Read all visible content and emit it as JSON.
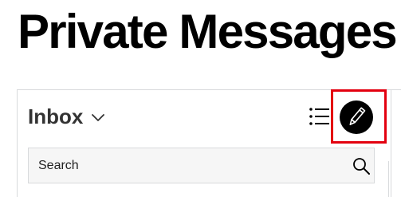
{
  "page": {
    "title": "Private Messages"
  },
  "inbox": {
    "folder_label": "Inbox",
    "folder_icon": "chevron-down-icon"
  },
  "toolbar": {
    "list_view_icon": "list-icon",
    "compose_icon": "pencil-icon",
    "compose_highlight_color": "#e3000f"
  },
  "search": {
    "placeholder": "Search",
    "value": "",
    "icon": "search-icon"
  },
  "colors": {
    "text": "#000000",
    "inbox_text": "#333333",
    "border": "#d8dadc",
    "search_background": "#f6f6f6",
    "compose_background": "#000000",
    "highlight": "#e3000f"
  }
}
